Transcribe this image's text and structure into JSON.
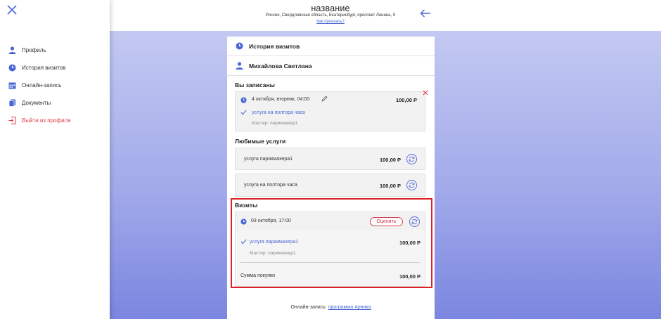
{
  "sidebar": {
    "items": [
      {
        "label": "Профиль",
        "icon": "user-icon"
      },
      {
        "label": "История визитов",
        "icon": "clock-icon"
      },
      {
        "label": "Онлайн-запись",
        "icon": "calendar-icon"
      },
      {
        "label": "Документы",
        "icon": "documents-icon"
      },
      {
        "label": "Выйти из профиля",
        "icon": "logout-icon"
      }
    ]
  },
  "header": {
    "title": "название",
    "address": "Россия, Свердловская область, Екатеринбург, проспект Ленина, 5",
    "route_link": "Как проехать?"
  },
  "card": {
    "history_label": "История визитов",
    "user_name": "Михайлова Светлана",
    "booked": {
      "title": "Вы записаны",
      "datetime": "4 октября, вторник, 04:00",
      "price": "100,00 Р",
      "service": "услуга на полтора часа",
      "master": "Мастер: парикмахер1"
    },
    "favorites": {
      "title": "Любимые услуги",
      "items": [
        {
          "name": "услуга парикмахера1",
          "price": "100,00 Р"
        },
        {
          "name": "услуга на полтора часа",
          "price": "100,00 Р"
        }
      ]
    },
    "visits": {
      "title": "Визиты",
      "datetime": "03 октября, 17:00",
      "rate_label": "Оценить",
      "service": "услуга парикмахера1",
      "service_price": "100,00 Р",
      "master": "Мастер: парикмахер1",
      "total_label": "Сумма покупки",
      "total_price": "100,00 Р"
    },
    "footer": {
      "prefix": "Онлайн-запись:",
      "link": "программа Арника"
    }
  },
  "colors": {
    "accent": "#4a67d6",
    "danger": "#e0394a",
    "highlight": "#e02027"
  }
}
